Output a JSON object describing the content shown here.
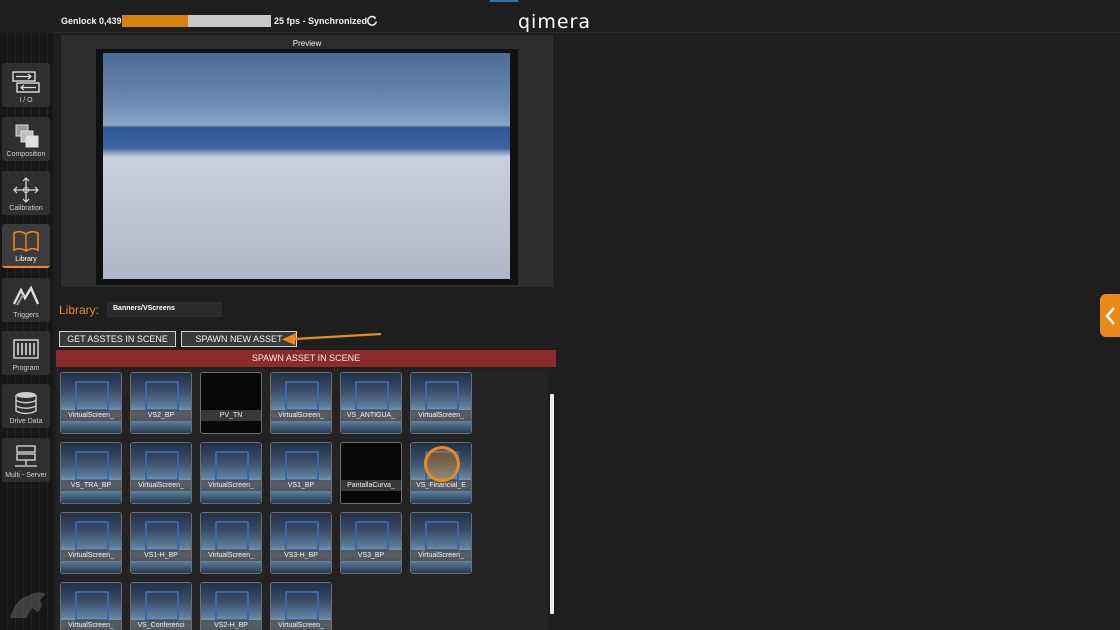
{
  "topbar": {
    "genlock_label": "Genlock 0,439",
    "genlock_progress": 0.44,
    "fps_label": "25 fps - Synchronized",
    "brand": "qimera"
  },
  "sidebar": {
    "items": [
      {
        "label": "I / O",
        "icon": "io-icon"
      },
      {
        "label": "Composition",
        "icon": "composition-icon"
      },
      {
        "label": "Calibration",
        "icon": "calibration-icon"
      },
      {
        "label": "Library",
        "icon": "library-icon",
        "active": true
      },
      {
        "label": "Triggers",
        "icon": "triggers-icon"
      },
      {
        "label": "Program",
        "icon": "program-icon"
      },
      {
        "label": "Drive Data",
        "icon": "drive-data-icon"
      },
      {
        "label": "Multi - Server",
        "icon": "multi-server-icon"
      }
    ]
  },
  "preview": {
    "title": "Preview"
  },
  "library": {
    "label": "Library:",
    "path": "Banners/VScreens",
    "get_assets_label": "GET ASSTES IN SCENE",
    "spawn_new_label": "SPAWN NEW ASSET",
    "spawn_bar_label": "SPAWN ASSET IN SCENE",
    "assets": [
      "VirtualScreen_",
      "VS2_BP",
      "PV_TN",
      "VirtualScreen_",
      "VS_ANTIGUA_",
      "VirtualScreen_",
      "VS_TRA_BP",
      "VirtualScreen_",
      "VirtualScreen_",
      "VS1_BP",
      "PantallaCurva_",
      "VS_Financial_E",
      "VirtualScreen_",
      "VS1-H_BP",
      "VirtualScreen_",
      "VS3-H_BP",
      "VS3_BP",
      "VirtualScreen_",
      "VirtualScreen_",
      "VS_Conferenci",
      "VS2-H_BP",
      "VirtualScreen_"
    ]
  },
  "colors": {
    "accent": "#e98a1b",
    "spawn_bar": "#8c2b2b"
  }
}
